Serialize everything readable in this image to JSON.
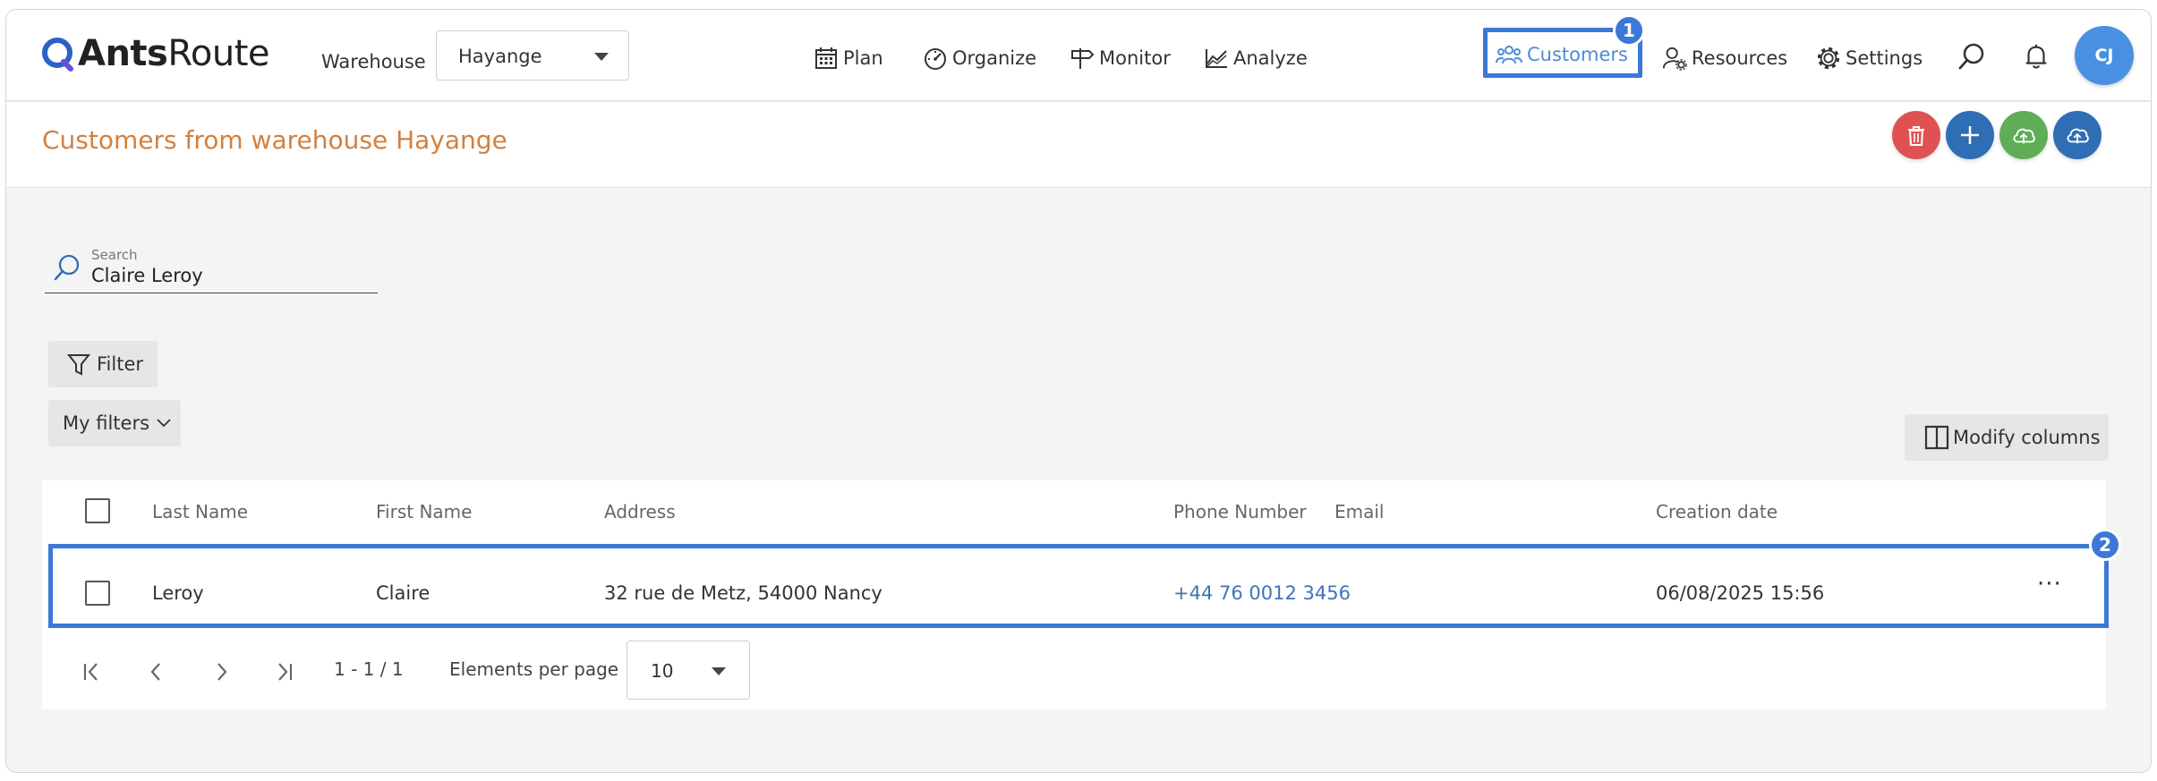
{
  "app": {
    "logo_text_bold": "Ants",
    "logo_text_light": "Route"
  },
  "header": {
    "warehouse_label": "Warehouse",
    "warehouse_value": "Hayange",
    "nav": {
      "plan": "Plan",
      "organize": "Organize",
      "monitor": "Monitor",
      "analyze": "Analyze",
      "customers": "Customers",
      "resources": "Resources",
      "settings": "Settings"
    },
    "avatar_initials": "CJ"
  },
  "markers": {
    "one": "1",
    "two": "2"
  },
  "page": {
    "title": "Customers from warehouse Hayange"
  },
  "search": {
    "label": "Search",
    "value": "Claire Leroy"
  },
  "filters": {
    "filter_label": "Filter",
    "my_filters_label": "My filters",
    "modify_columns_label": "Modify columns"
  },
  "table": {
    "headers": [
      "Last Name",
      "First Name",
      "Address",
      "Phone Number",
      "Email",
      "Creation date"
    ],
    "rows": [
      {
        "last_name": "Leroy",
        "first_name": "Claire",
        "address": "32 rue de Metz, 54000 Nancy",
        "phone": "+44 76 0012 3456",
        "email": "",
        "creation_date": "06/08/2025 15:56"
      }
    ],
    "row_menu": "···"
  },
  "pagination": {
    "range": "1 - 1 / 1",
    "per_page_label": "Elements per page",
    "per_page_value": "10"
  },
  "colors": {
    "accent_blue": "#3b78d8",
    "title_orange": "#d2803f",
    "delete_red": "#e05252",
    "add_blue": "#2f6db5",
    "import_green": "#5fae57",
    "export_blue": "#2f6db5"
  }
}
